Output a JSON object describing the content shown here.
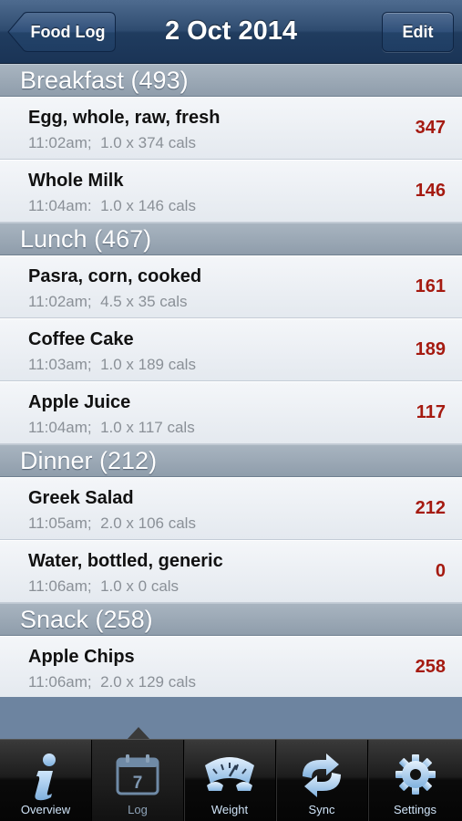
{
  "navbar": {
    "back_label": "Food Log",
    "title": "2 Oct 2014",
    "edit_label": "Edit"
  },
  "sections": [
    {
      "header": "Breakfast (493)",
      "items": [
        {
          "name": "Egg, whole, raw, fresh",
          "detail": "11:02am;  1.0 x 374 cals",
          "cals": "347"
        },
        {
          "name": "Whole Milk",
          "detail": "11:04am:  1.0 x 146 cals",
          "cals": "146"
        }
      ]
    },
    {
      "header": "Lunch (467)",
      "items": [
        {
          "name": "Pasra, corn, cooked",
          "detail": "11:02am;  4.5 x 35 cals",
          "cals": "161"
        },
        {
          "name": "Coffee Cake",
          "detail": "11:03am;  1.0 x 189 cals",
          "cals": "189"
        },
        {
          "name": "Apple Juice",
          "detail": "11:04am;  1.0 x 117 cals",
          "cals": "117"
        }
      ]
    },
    {
      "header": "Dinner (212)",
      "items": [
        {
          "name": "Greek Salad",
          "detail": "11:05am;  2.0 x 106 cals",
          "cals": "212"
        },
        {
          "name": "Water, bottled, generic",
          "detail": "11:06am;  1.0 x 0 cals",
          "cals": "0"
        }
      ]
    },
    {
      "header": "Snack (258)",
      "items": [
        {
          "name": "Apple Chips",
          "detail": "11:06am;  2.0 x 129 cals",
          "cals": "258"
        }
      ]
    }
  ],
  "tabbar": {
    "tabs": [
      {
        "label": "Overview",
        "icon": "info-icon"
      },
      {
        "label": "Log",
        "icon": "calendar-icon",
        "calendar_day": "7",
        "selected": true
      },
      {
        "label": "Weight",
        "icon": "scale-icon"
      },
      {
        "label": "Sync",
        "icon": "sync-icon"
      },
      {
        "label": "Settings",
        "icon": "gear-icon"
      }
    ]
  },
  "colors": {
    "calorie_value": "#a51a10",
    "navbar": "#2f4c70",
    "tab_label": "#cfe3f7",
    "tab_icon_blue": "#9fc9ee"
  }
}
